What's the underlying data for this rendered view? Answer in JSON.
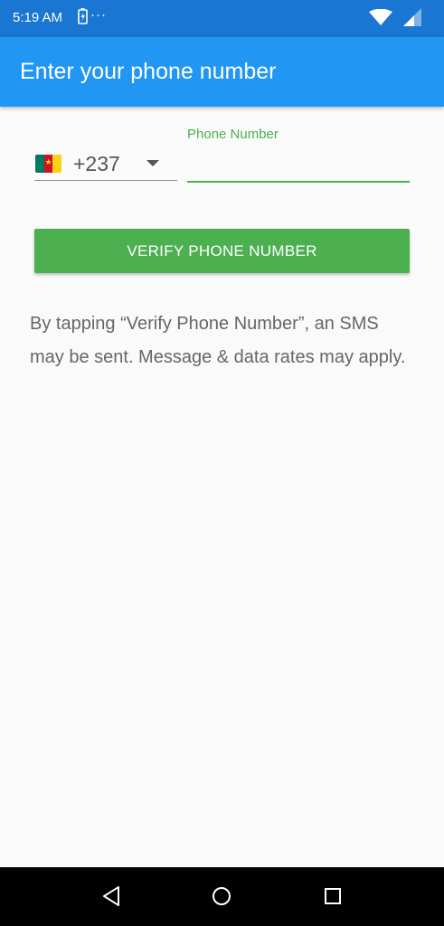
{
  "status_bar": {
    "time": "5:19 AM",
    "dots": "···",
    "icons": [
      "battery-alert-icon",
      "wifi-icon",
      "signal-icon"
    ]
  },
  "app_bar": {
    "title": "Enter your phone number",
    "color": "#2196f3"
  },
  "country_picker": {
    "flag": "cameroon-flag-icon",
    "dial_code": "+237"
  },
  "phone_field": {
    "label": "Phone Number",
    "value": "",
    "accent_color": "#4caf50"
  },
  "verify_button": {
    "label": "VERIFY PHONE NUMBER",
    "color": "#4caf50"
  },
  "disclaimer": "By tapping “Verify Phone Number”, an SMS may be sent. Message & data rates may apply.",
  "nav_bar": {
    "icons": [
      "back-icon",
      "home-icon",
      "recents-icon"
    ]
  }
}
